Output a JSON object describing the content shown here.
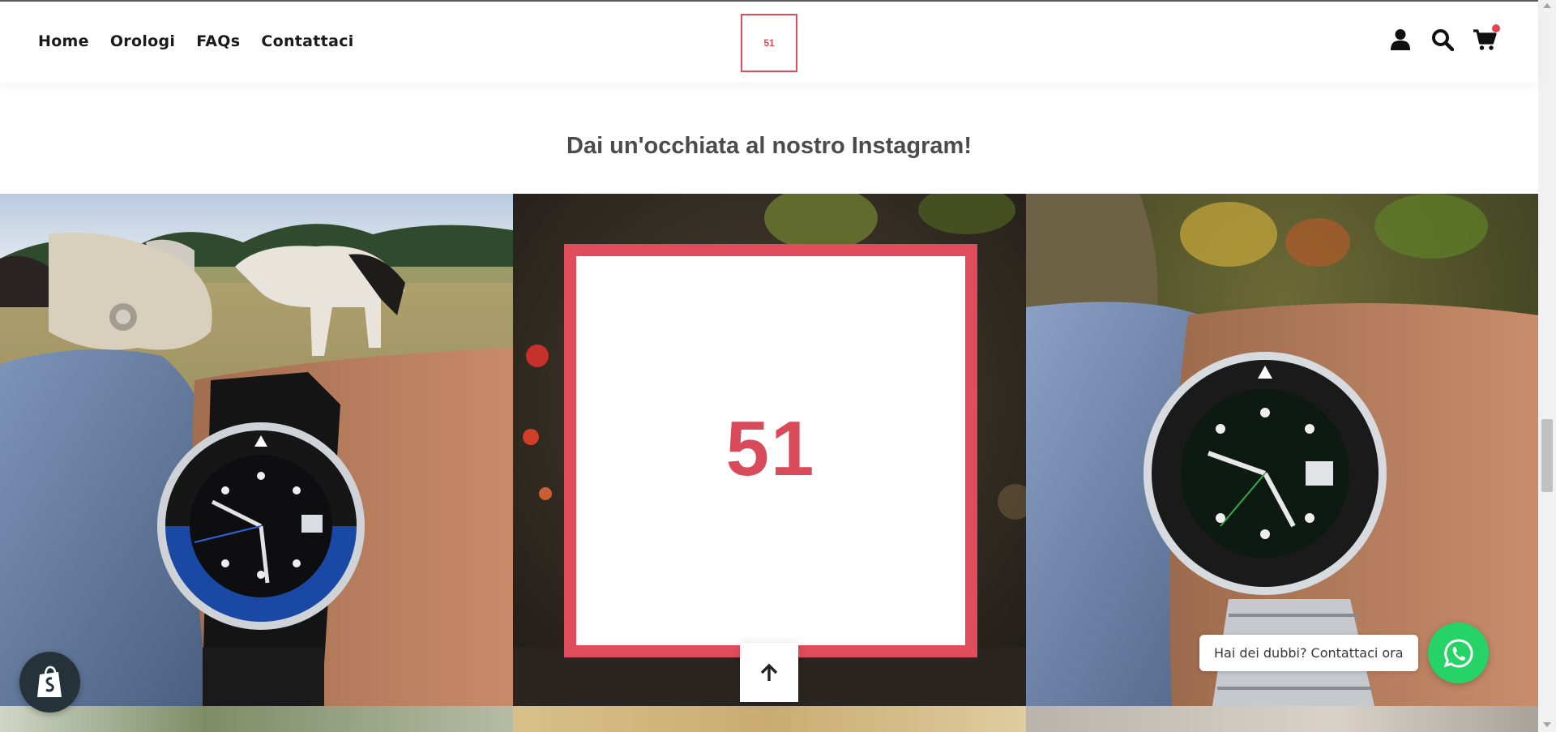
{
  "nav": {
    "items": [
      {
        "label": "Home"
      },
      {
        "label": "Orologi"
      },
      {
        "label": "FAQs"
      },
      {
        "label": "Contattaci"
      }
    ]
  },
  "logo": {
    "text": "51",
    "color": "#df4d5f"
  },
  "header_icons": [
    "user-icon",
    "search-icon",
    "cart-icon"
  ],
  "instagram": {
    "title": "Dai un'occhiata al nostro Instagram!",
    "promo_text": "51",
    "accent": "#e04c5c"
  },
  "whatsapp": {
    "label": "Hai dei dubbi? Contattaci ora",
    "color": "#25d366"
  },
  "floating": {
    "back_to_top_icon": "arrow-up-icon",
    "shopify_icon": "shopify-bag-icon"
  }
}
